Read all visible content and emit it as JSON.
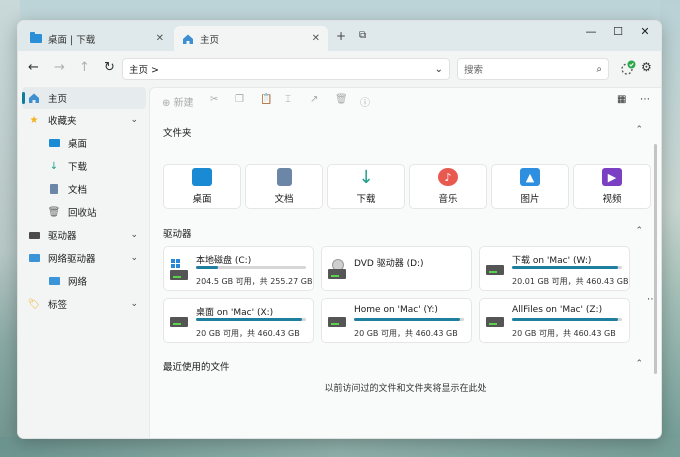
{
  "tabs": [
    {
      "label": "桌面 | 下载"
    },
    {
      "label": "主页"
    }
  ],
  "address": {
    "path": "主页 >"
  },
  "search": {
    "placeholder": "搜索"
  },
  "toolbar": {
    "new_label": "新建"
  },
  "sidebar": {
    "items": [
      {
        "label": "主页"
      },
      {
        "label": "收藏夹"
      },
      {
        "label": "桌面"
      },
      {
        "label": "下载"
      },
      {
        "label": "文档"
      },
      {
        "label": "回收站"
      },
      {
        "label": "驱动器"
      },
      {
        "label": "网络驱动器"
      },
      {
        "label": "网络"
      },
      {
        "label": "标签"
      }
    ]
  },
  "main": {
    "folders_title": "文件夹",
    "folders": [
      {
        "label": "桌面",
        "color": "#1a8ad4"
      },
      {
        "label": "文档",
        "color": "#5a7fa8"
      },
      {
        "label": "下载",
        "color": "#1f9e8a"
      },
      {
        "label": "音乐",
        "color": "#e85a4f"
      },
      {
        "label": "图片",
        "color": "#2e8fe0"
      },
      {
        "label": "视频",
        "color": "#7a3fc2"
      }
    ],
    "drives_title": "驱动器",
    "drives": [
      {
        "name": "本地磁盘 (C:)",
        "size": "204.5 GB 可用，共 255.27 GB",
        "used": 0.2
      },
      {
        "name": "DVD 驱动器 (D:)",
        "size": "",
        "used": 0
      },
      {
        "name": "下载 on 'Mac' (W:)",
        "size": "20.01 GB 可用，共 460.43 GB",
        "used": 0.96
      },
      {
        "name": "桌面 on 'Mac' (X:)",
        "size": "20 GB 可用，共 460.43 GB",
        "used": 0.96
      },
      {
        "name": "Home on 'Mac' (Y:)",
        "size": "20 GB 可用，共 460.43 GB",
        "used": 0.96
      },
      {
        "name": "AllFiles on 'Mac' (Z:)",
        "size": "20 GB 可用，共 460.43 GB",
        "used": 0.96
      }
    ],
    "recent_title": "最近使用的文件",
    "recent_empty": "以前访问过的文件和文件夹将显示在此处"
  }
}
